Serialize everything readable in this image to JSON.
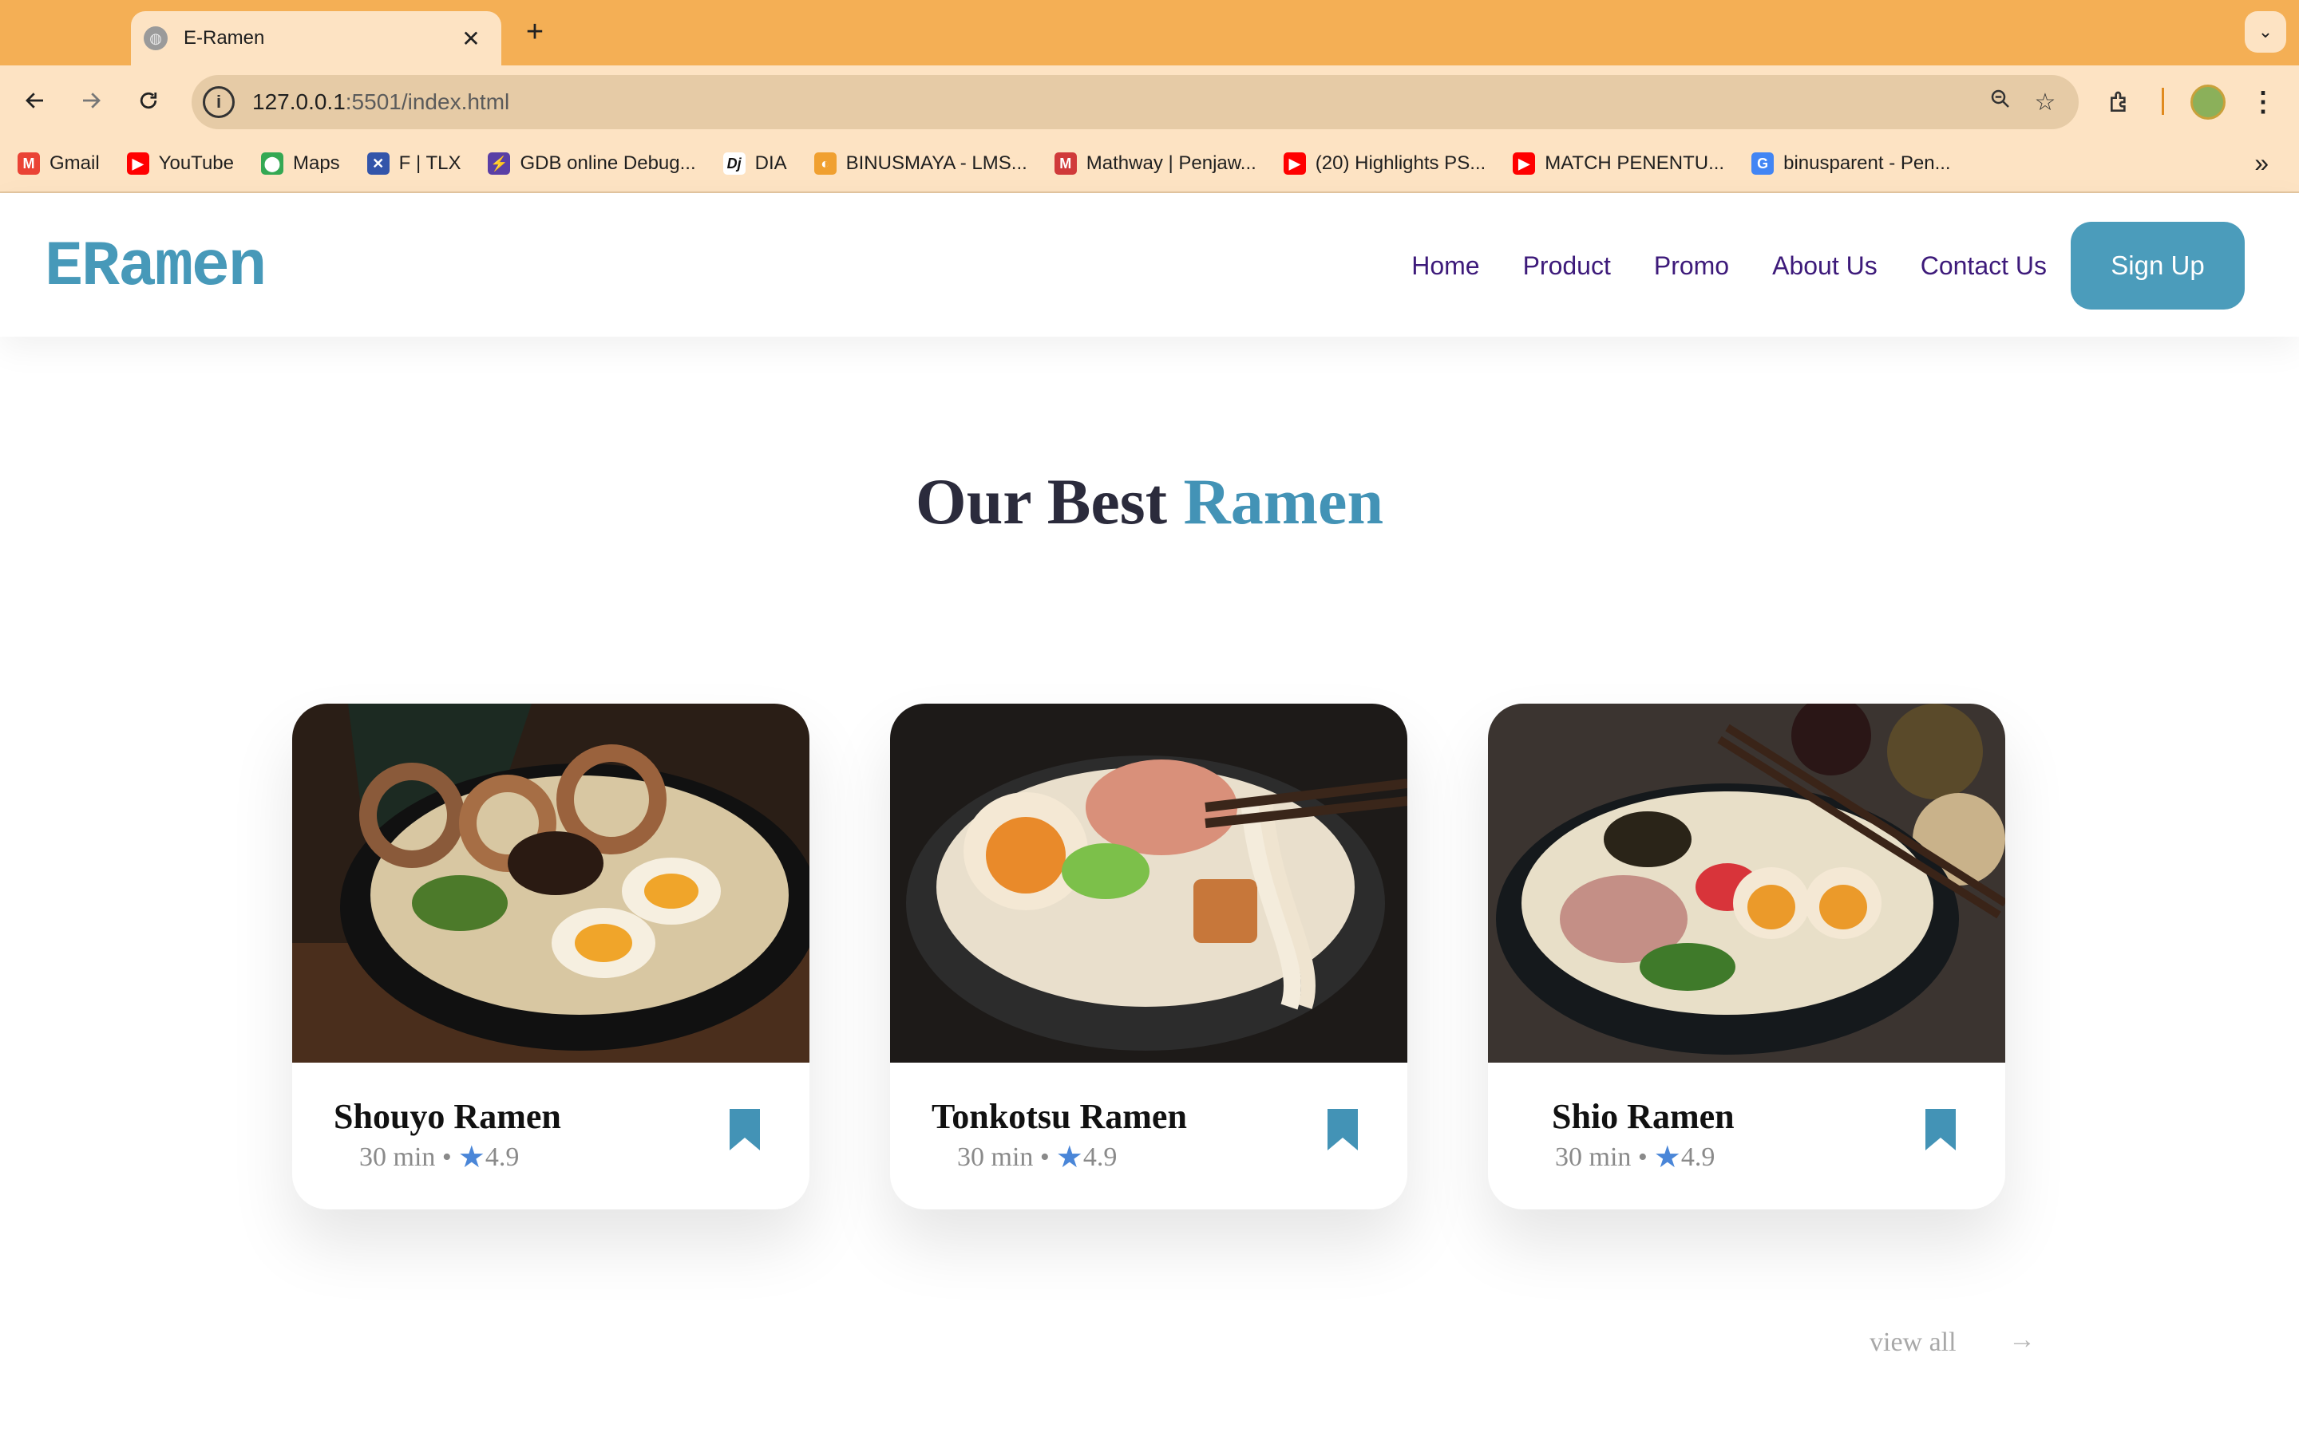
{
  "browser": {
    "tab_title": "E-Ramen",
    "tab_close": "✕",
    "new_tab": "+",
    "tab_search": "⌄",
    "url_host": "127.0.0.1",
    "url_rest": ":5501/index.html",
    "bookmarks": [
      {
        "label": "Gmail",
        "icon": "gmail-icon",
        "color": "#ea4335",
        "glyph": "M"
      },
      {
        "label": "YouTube",
        "icon": "youtube-icon",
        "color": "#ff0000",
        "glyph": "▶"
      },
      {
        "label": "Maps",
        "icon": "maps-icon",
        "color": "#34a853",
        "glyph": "⬤"
      },
      {
        "label": "F | TLX",
        "icon": "tlx-icon",
        "color": "#3355aa",
        "glyph": "✕"
      },
      {
        "label": "GDB online Debug...",
        "icon": "gdb-icon",
        "color": "#5a3fa6",
        "glyph": "⚡"
      },
      {
        "label": "DIA",
        "icon": "dia-icon",
        "color": "#ffffff",
        "glyph": "Dj"
      },
      {
        "label": "BINUSMAYA - LMS...",
        "icon": "binusmaya-icon",
        "color": "#f0a030",
        "glyph": "◐"
      },
      {
        "label": "Mathway | Penjaw...",
        "icon": "mathway-icon",
        "color": "#d03a3a",
        "glyph": "M"
      },
      {
        "label": "(20) Highlights PS...",
        "icon": "youtube-icon",
        "color": "#ff0000",
        "glyph": "▶"
      },
      {
        "label": "MATCH PENENTU...",
        "icon": "youtube-icon",
        "color": "#ff0000",
        "glyph": "▶"
      },
      {
        "label": "binusparent - Pen...",
        "icon": "google-icon",
        "color": "#4285f4",
        "glyph": "G"
      }
    ],
    "bookmarks_more": "»"
  },
  "site": {
    "logo": "ERamen",
    "nav": [
      "Home",
      "Product",
      "Promo",
      "About Us",
      "Contact Us"
    ],
    "signup": "Sign Up"
  },
  "section": {
    "title_main": "Our Best",
    "title_accent": "Ramen"
  },
  "cards": [
    {
      "name": "Shouyo Ramen",
      "time": "30 min •",
      "rating": "4.9"
    },
    {
      "name": "Tonkotsu Ramen",
      "time": "30 min •",
      "rating": "4.9"
    },
    {
      "name": "Shio Ramen",
      "time": "30 min •",
      "rating": "4.9"
    }
  ],
  "footer": {
    "view_all": "view all",
    "arrow": "→"
  },
  "colors": {
    "accent": "#4799b9",
    "nav_text": "#3d1a7a",
    "tab_bar": "#f4af55",
    "star": "#4a86d8"
  }
}
